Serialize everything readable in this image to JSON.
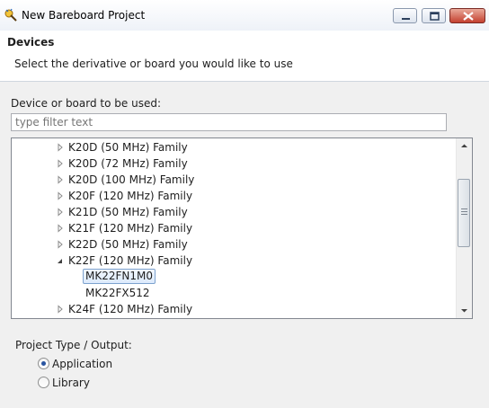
{
  "window": {
    "title": "New Bareboard Project",
    "icons": {
      "app": "eclipse-wizard-icon",
      "minimize": "minimize-icon",
      "maximize": "maximize-icon",
      "close": "close-icon"
    }
  },
  "header": {
    "title": "Devices",
    "description": "Select the derivative or board you would like to use"
  },
  "device_picker": {
    "label": "Device or board to be used:",
    "filter_placeholder": "type filter text",
    "tree": [
      {
        "label": "K20D (50 MHz) Family",
        "expanded": false,
        "level": 1
      },
      {
        "label": "K20D (72 MHz) Family",
        "expanded": false,
        "level": 1
      },
      {
        "label": "K20D (100 MHz) Family",
        "expanded": false,
        "level": 1
      },
      {
        "label": "K20F (120 MHz) Family",
        "expanded": false,
        "level": 1
      },
      {
        "label": "K21D (50 MHz) Family",
        "expanded": false,
        "level": 1
      },
      {
        "label": "K21F (120 MHz) Family",
        "expanded": false,
        "level": 1
      },
      {
        "label": "K22D (50 MHz) Family",
        "expanded": false,
        "level": 1
      },
      {
        "label": "K22F (120 MHz) Family",
        "expanded": true,
        "level": 1
      },
      {
        "label": "MK22FN1M0",
        "level": 2,
        "selected": true
      },
      {
        "label": "MK22FX512",
        "level": 2,
        "selected": false
      },
      {
        "label": "K24F (120 MHz) Family",
        "expanded": false,
        "level": 1
      }
    ]
  },
  "project_type": {
    "label": "Project Type / Output:",
    "options": [
      {
        "label": "Application",
        "checked": true
      },
      {
        "label": "Library",
        "checked": false
      }
    ]
  },
  "colors": {
    "selection_border": "#7da2ce",
    "selection_fill": "#dceafc",
    "radio_dot": "#2a55a1",
    "panel_bg": "#f0f0f0"
  }
}
